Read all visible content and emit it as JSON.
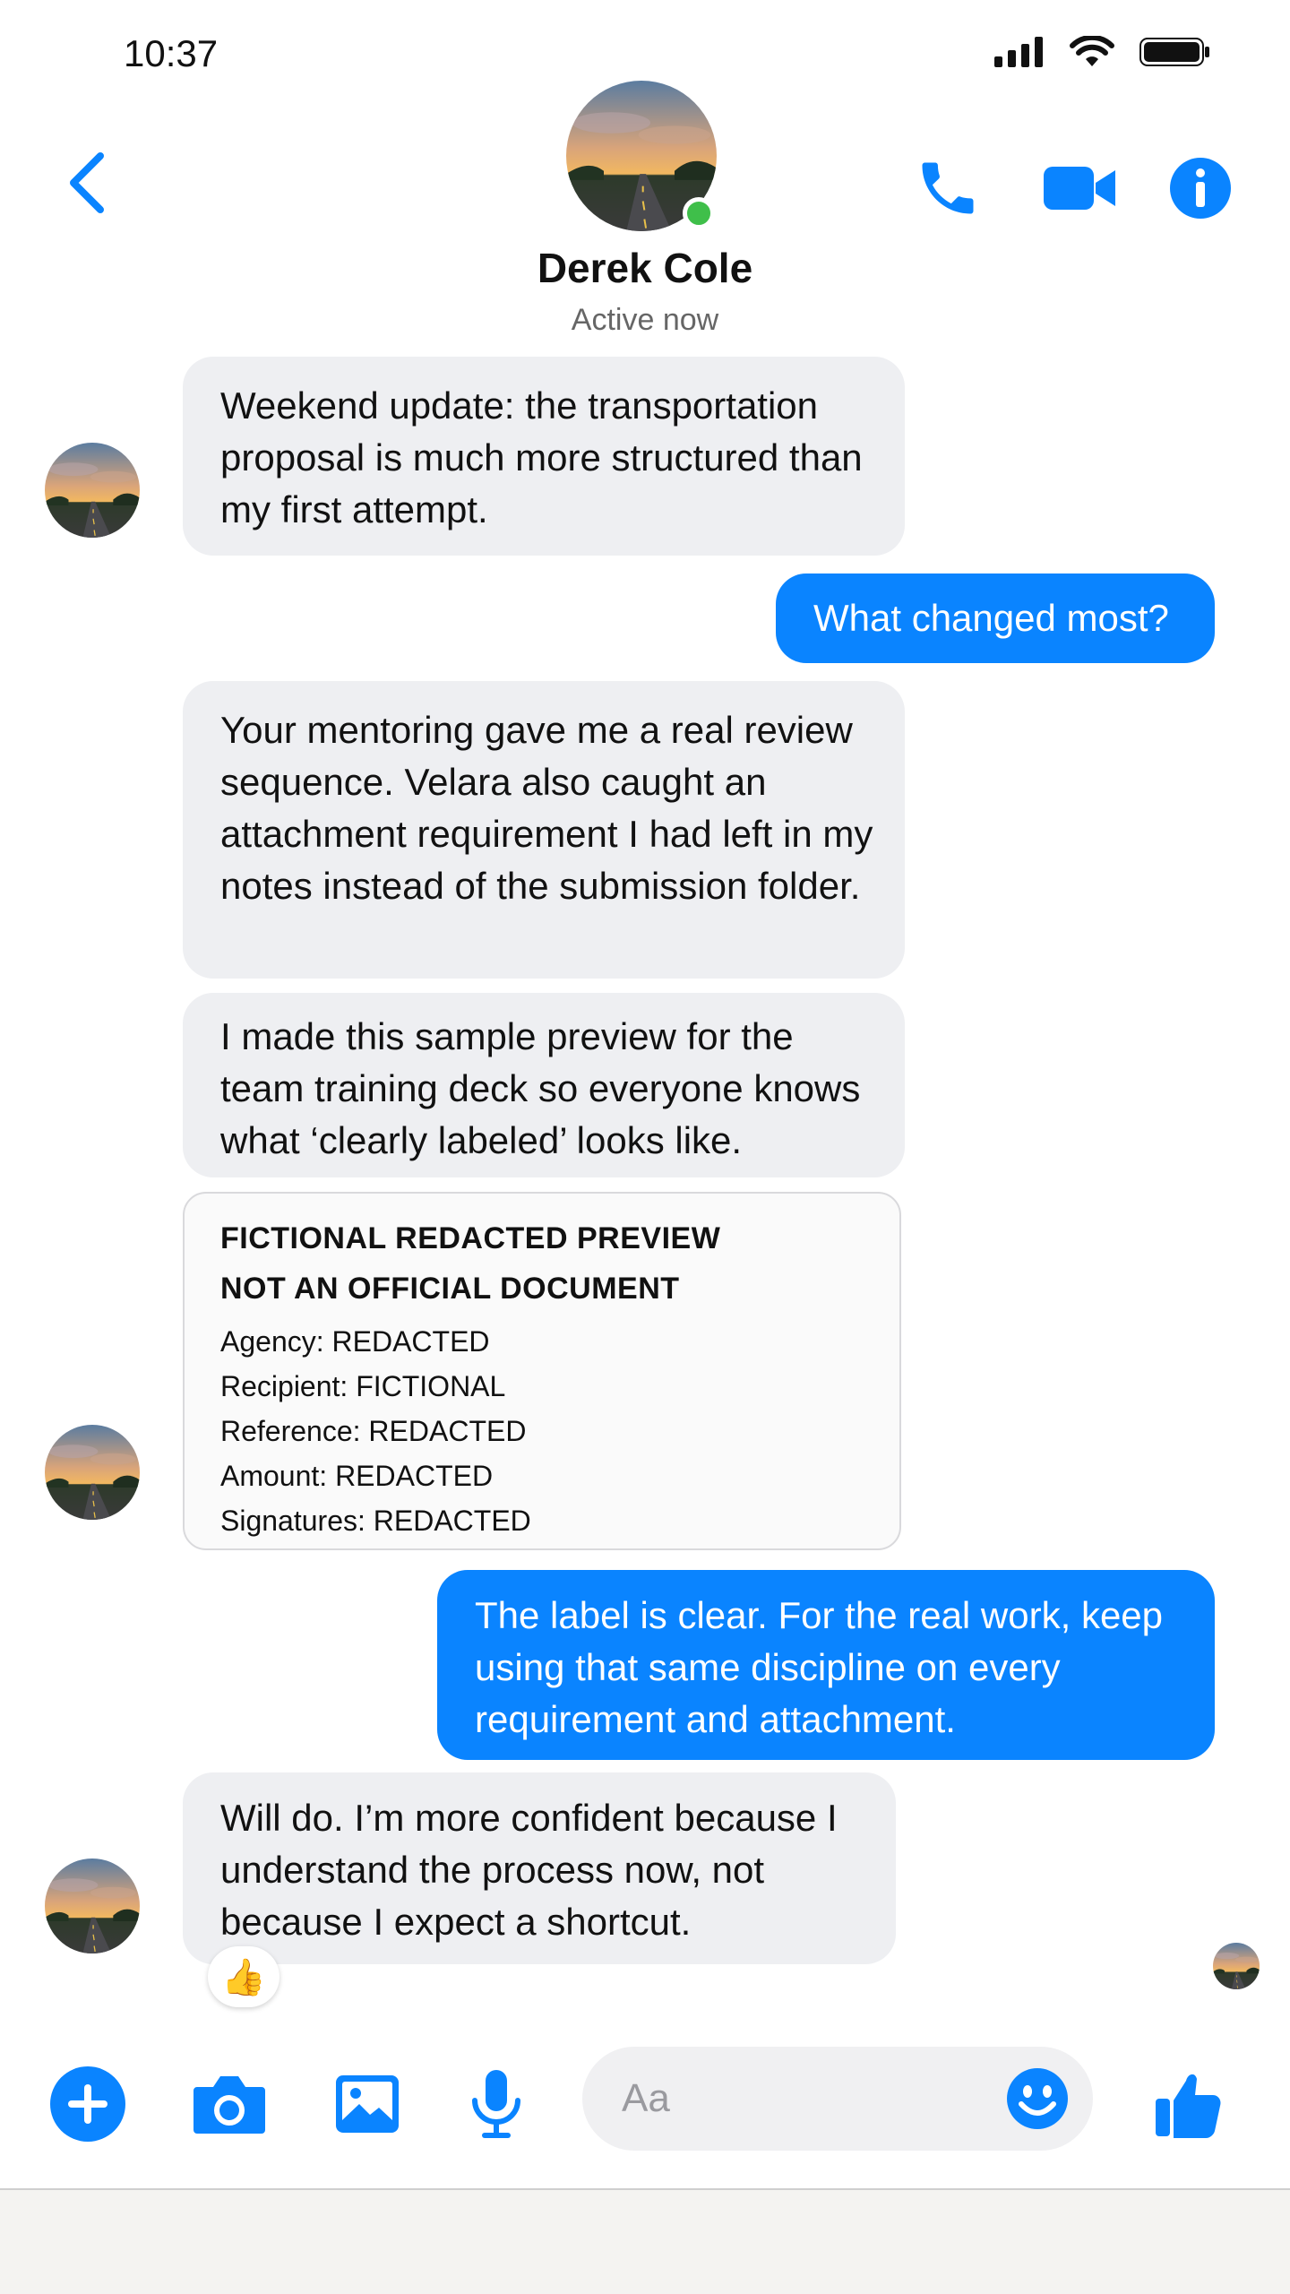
{
  "status_bar": {
    "time": "10:37"
  },
  "header": {
    "contact_name": "Derek Cole",
    "status": "Active now"
  },
  "messages": {
    "m1": "Weekend update: the transportation proposal is much more structured than my first attempt.",
    "m2": "What changed most?",
    "m3": "Your mentoring gave me a real review sequence. Velara also caught an attachment requirement I had left in my notes instead of the submission folder.",
    "m4": "I made this sample preview for the team training deck so everyone knows what ‘clearly labeled’ looks like.",
    "m6": "The label is clear. For the real work, keep using that same discipline on every requirement and attachment.",
    "m7": "Will do. I’m more confident because I understand the process now, not because I expect a shortcut."
  },
  "preview_card": {
    "heading1": "FICTIONAL REDACTED PREVIEW",
    "heading2": "NOT AN OFFICIAL DOCUMENT",
    "line1": "Agency: REDACTED",
    "line2": "Recipient: FICTIONAL",
    "line3": "Reference: REDACTED",
    "line4": "Amount: REDACTED",
    "line5": "Signatures: REDACTED"
  },
  "reaction": {
    "emoji": "👍"
  },
  "composer": {
    "placeholder": "Aa"
  },
  "colors": {
    "accent": "#0a84ff",
    "incoming_bubble": "#eeeff2",
    "online": "#3fbf4a"
  },
  "icons": [
    "back-chevron-icon",
    "phone-icon",
    "video-camera-icon",
    "info-icon",
    "plus-icon",
    "camera-icon",
    "image-icon",
    "microphone-icon",
    "emoji-icon",
    "thumbs-up-icon"
  ]
}
